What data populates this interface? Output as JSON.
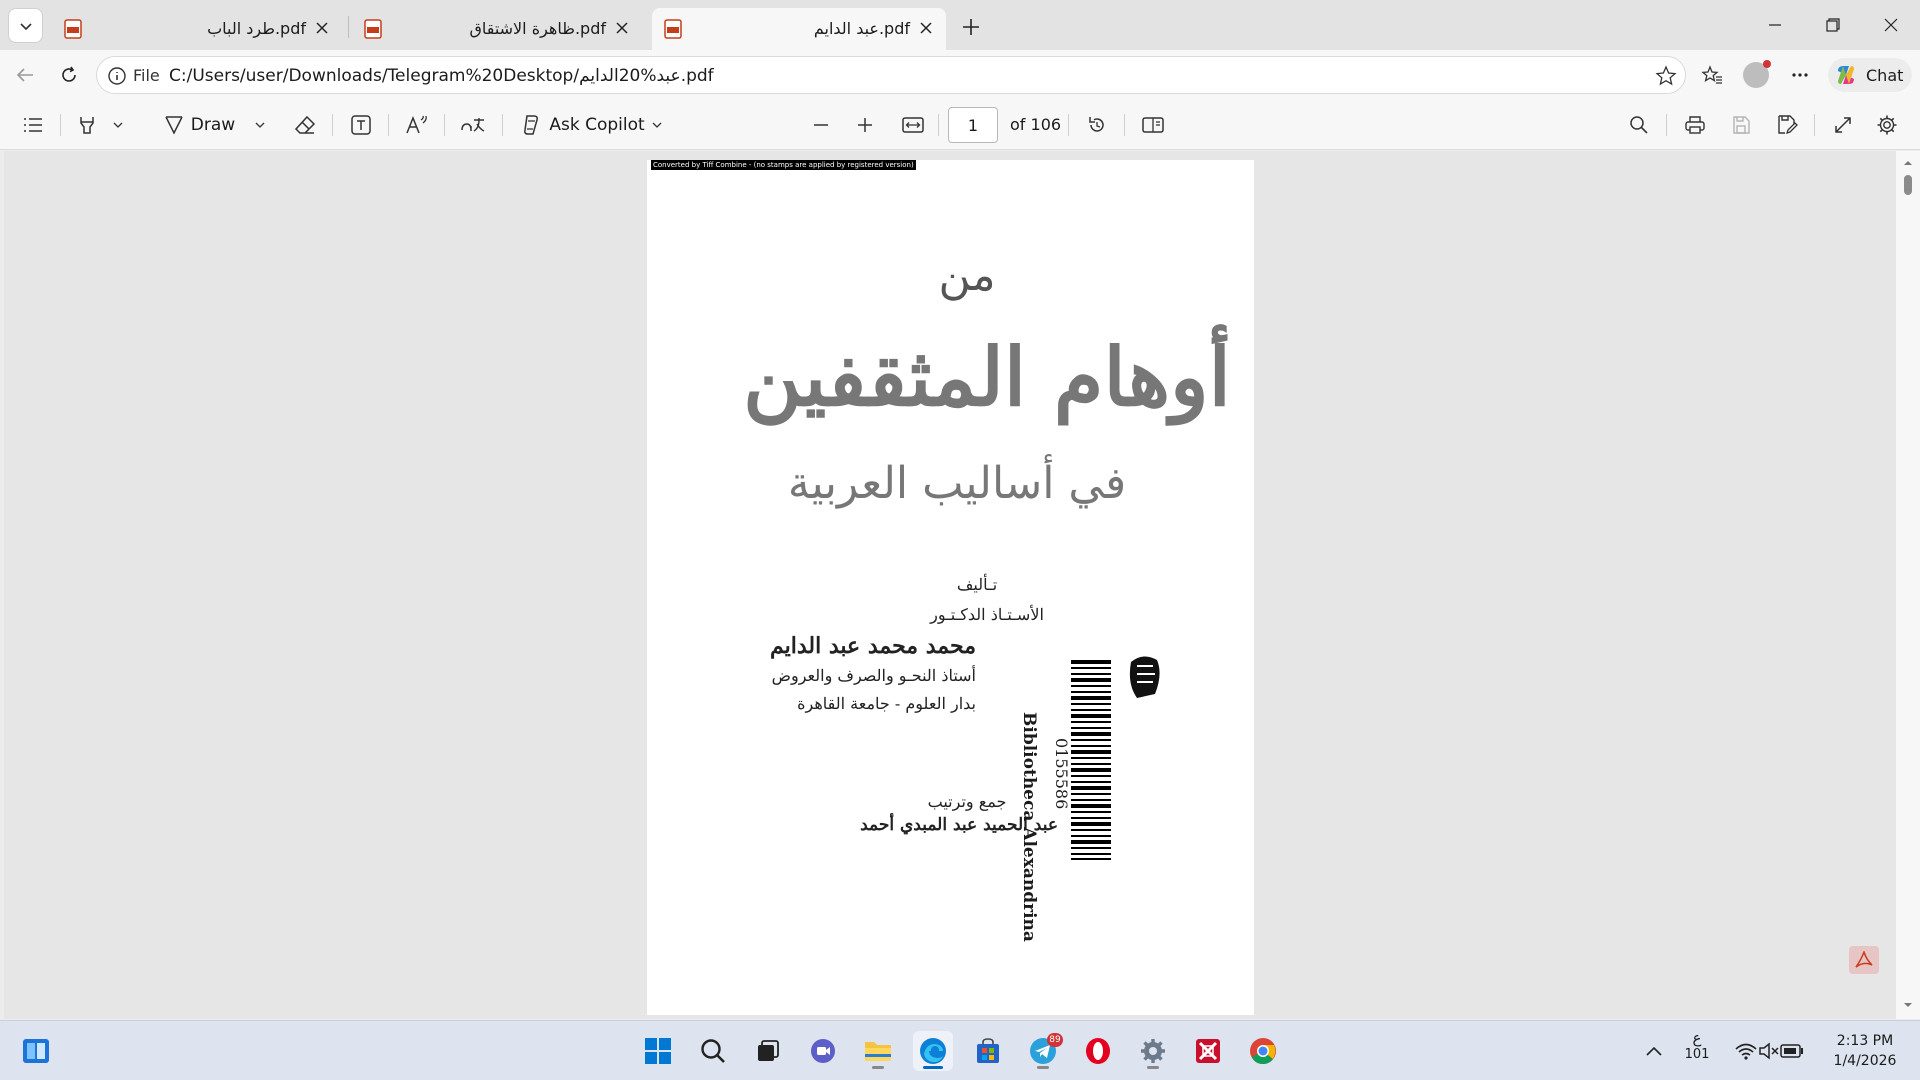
{
  "tabs": [
    {
      "title": "طرد الباب.pdf",
      "active": false
    },
    {
      "title": "ظاهرة الاشتقاق.pdf",
      "active": false
    },
    {
      "title": "عبد الدايم.pdf",
      "active": true
    }
  ],
  "address": {
    "file_label": "File",
    "url": "C:/Users/user/Downloads/Telegram%20Desktop/عبد%20الدايم.pdf"
  },
  "chat_label": "Chat",
  "pdf_toolbar": {
    "draw_label": "Draw",
    "copilot_label": "Ask Copilot",
    "page_value": "1",
    "page_count": "of 106"
  },
  "page": {
    "banner": "Converted by Tiff Combine - (no stamps are applied by registered version)",
    "min": "من",
    "title": "أوهام المثقفين",
    "subtitle": "في أساليب العربية",
    "authored_label": "تـأليف",
    "prof_label": "الأسـتـاذ الدكـتـور",
    "author": "محمد محمد عبد الدايم",
    "role1": "أستاذ النحـو والصرف والعروض",
    "role2": "بدار العلوم - جامعة القاهرة",
    "compiled_label": "جمع وترتيب",
    "editor": "عبد الحميد عبد المبدي أحمد",
    "library": "Bibliotheca Alexandrina",
    "barcode_number": "0155586"
  },
  "taskbar": {
    "telegram_badge": "89",
    "ime_char": "ع",
    "ime_num": "101",
    "time": "2:13 PM",
    "date": "1/4/2026"
  }
}
